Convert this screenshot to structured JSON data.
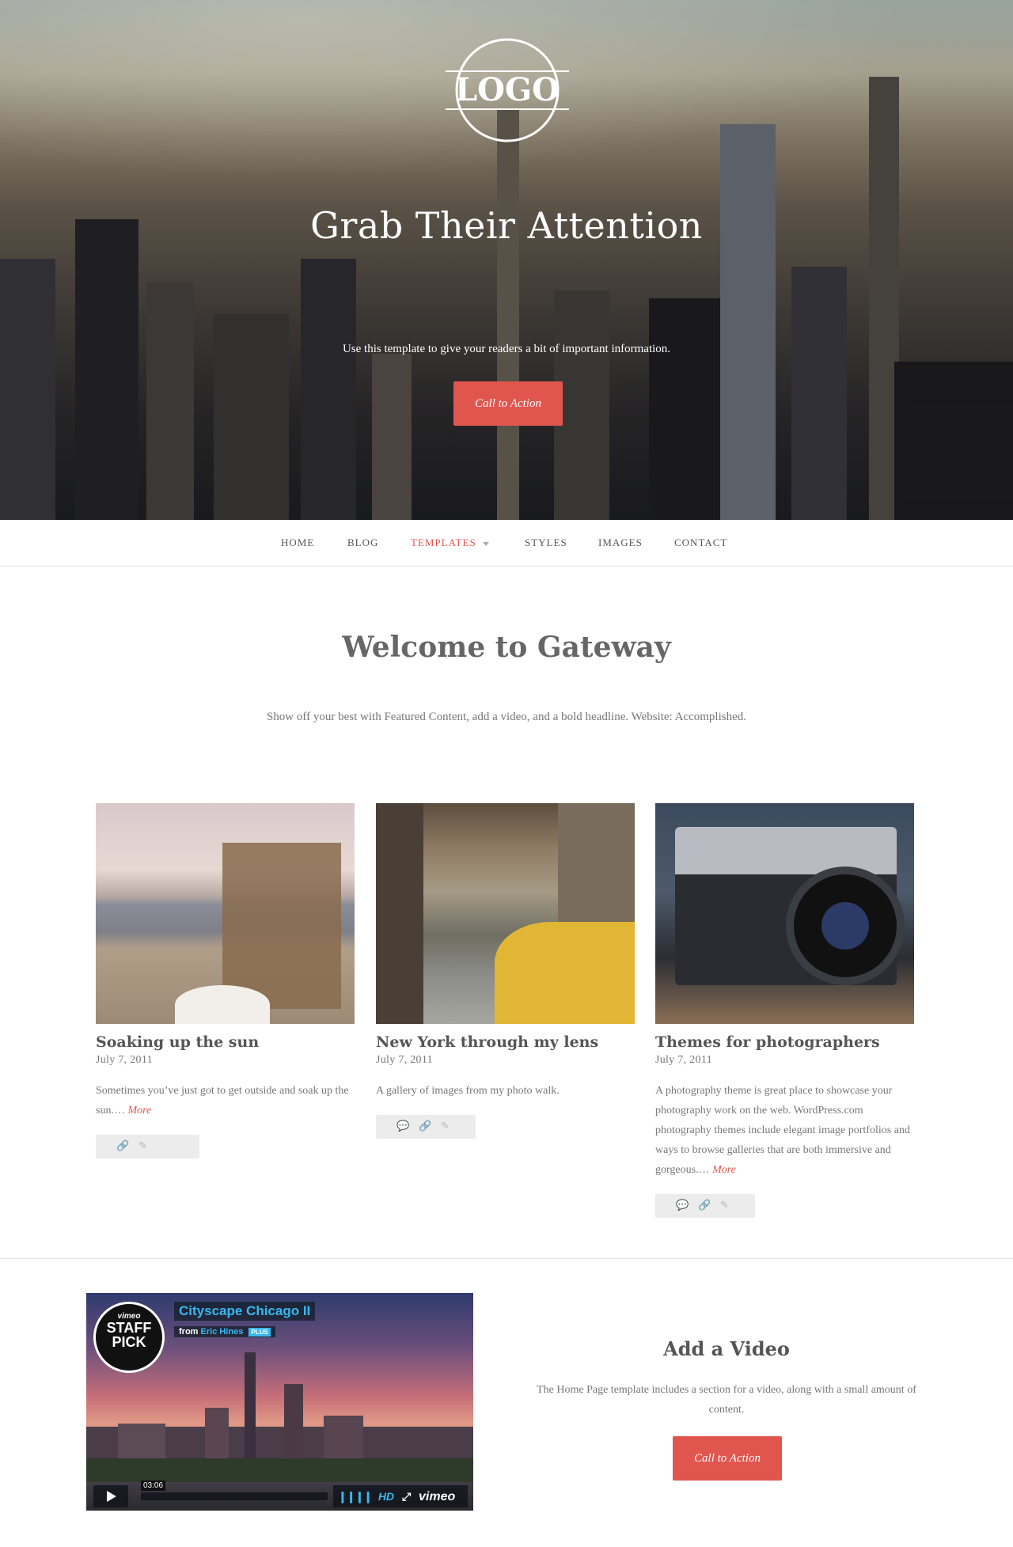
{
  "hero": {
    "logo_text": "LOGO",
    "title": "Grab Their Attention",
    "subtitle": "Use this template to give your readers a bit of important information.",
    "cta_label": "Call to Action"
  },
  "nav": {
    "items": [
      {
        "label": "HOME",
        "active": false
      },
      {
        "label": "BLOG",
        "active": false
      },
      {
        "label": "TEMPLATES",
        "active": true,
        "has_dropdown": true
      },
      {
        "label": "STYLES",
        "active": false
      },
      {
        "label": "IMAGES",
        "active": false
      },
      {
        "label": "CONTACT",
        "active": false
      }
    ]
  },
  "welcome": {
    "title": "Welcome to Gateway",
    "text": "Show off your best with Featured Content, add a video, and a bold headline. Website: Accomplished."
  },
  "posts": [
    {
      "title": "Soaking up the sun",
      "date": "July 7, 2011",
      "excerpt": "Sometimes you’ve just got to get outside and soak up the sun.…",
      "more": "More",
      "meta_icons": [
        "link-icon",
        "edit-icon"
      ]
    },
    {
      "title": "New York through my lens",
      "date": "July 7, 2011",
      "excerpt": "A gallery of images from my photo walk.",
      "more": "",
      "meta_icons": [
        "comment-icon",
        "link-icon",
        "edit-icon"
      ]
    },
    {
      "title": "Themes for photographers",
      "date": "July 7, 2011",
      "excerpt": "A photography theme is great place to showcase your photography work on the web. WordPress.com photography themes include elegant image portfolios and ways to browse galleries that are both immersive and gorgeous.…",
      "more": "More",
      "meta_icons": [
        "comment-icon",
        "link-icon",
        "edit-icon"
      ]
    }
  ],
  "video": {
    "title": "Cityscape Chicago II",
    "by_prefix": "from",
    "author": "Eric Hines",
    "plus_badge": "PLUS",
    "staff_pick_brand": "vimeo",
    "staff_pick_line1": "STAFF",
    "staff_pick_line2": "PICK",
    "duration": "03:06",
    "hd_label": "HD",
    "player_brand": "vimeo"
  },
  "add_video": {
    "title": "Add a Video",
    "text": "The Home Page template includes a section for a video, along with a small amount of content.",
    "cta_label": "Call to Action"
  },
  "colors": {
    "accent": "#e0564f",
    "vimeo_blue": "#36b8f0"
  }
}
